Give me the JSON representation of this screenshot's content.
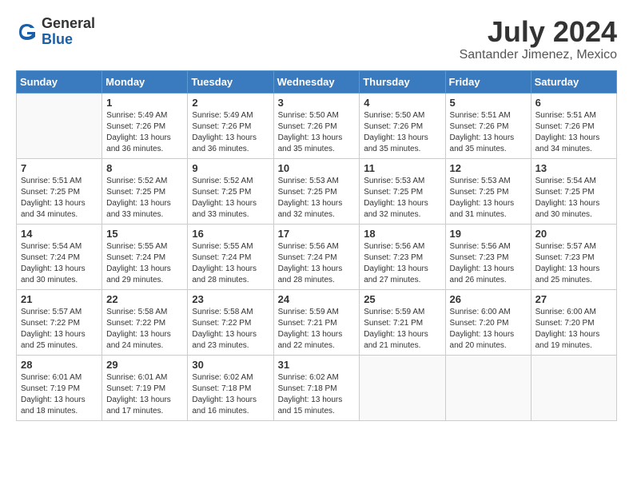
{
  "logo": {
    "general": "General",
    "blue": "Blue"
  },
  "title": {
    "month_year": "July 2024",
    "location": "Santander Jimenez, Mexico"
  },
  "headers": [
    "Sunday",
    "Monday",
    "Tuesday",
    "Wednesday",
    "Thursday",
    "Friday",
    "Saturday"
  ],
  "weeks": [
    [
      {
        "day": "",
        "info": ""
      },
      {
        "day": "1",
        "info": "Sunrise: 5:49 AM\nSunset: 7:26 PM\nDaylight: 13 hours\nand 36 minutes."
      },
      {
        "day": "2",
        "info": "Sunrise: 5:49 AM\nSunset: 7:26 PM\nDaylight: 13 hours\nand 36 minutes."
      },
      {
        "day": "3",
        "info": "Sunrise: 5:50 AM\nSunset: 7:26 PM\nDaylight: 13 hours\nand 35 minutes."
      },
      {
        "day": "4",
        "info": "Sunrise: 5:50 AM\nSunset: 7:26 PM\nDaylight: 13 hours\nand 35 minutes."
      },
      {
        "day": "5",
        "info": "Sunrise: 5:51 AM\nSunset: 7:26 PM\nDaylight: 13 hours\nand 35 minutes."
      },
      {
        "day": "6",
        "info": "Sunrise: 5:51 AM\nSunset: 7:26 PM\nDaylight: 13 hours\nand 34 minutes."
      }
    ],
    [
      {
        "day": "7",
        "info": "Sunrise: 5:51 AM\nSunset: 7:25 PM\nDaylight: 13 hours\nand 34 minutes."
      },
      {
        "day": "8",
        "info": "Sunrise: 5:52 AM\nSunset: 7:25 PM\nDaylight: 13 hours\nand 33 minutes."
      },
      {
        "day": "9",
        "info": "Sunrise: 5:52 AM\nSunset: 7:25 PM\nDaylight: 13 hours\nand 33 minutes."
      },
      {
        "day": "10",
        "info": "Sunrise: 5:53 AM\nSunset: 7:25 PM\nDaylight: 13 hours\nand 32 minutes."
      },
      {
        "day": "11",
        "info": "Sunrise: 5:53 AM\nSunset: 7:25 PM\nDaylight: 13 hours\nand 32 minutes."
      },
      {
        "day": "12",
        "info": "Sunrise: 5:53 AM\nSunset: 7:25 PM\nDaylight: 13 hours\nand 31 minutes."
      },
      {
        "day": "13",
        "info": "Sunrise: 5:54 AM\nSunset: 7:25 PM\nDaylight: 13 hours\nand 30 minutes."
      }
    ],
    [
      {
        "day": "14",
        "info": "Sunrise: 5:54 AM\nSunset: 7:24 PM\nDaylight: 13 hours\nand 30 minutes."
      },
      {
        "day": "15",
        "info": "Sunrise: 5:55 AM\nSunset: 7:24 PM\nDaylight: 13 hours\nand 29 minutes."
      },
      {
        "day": "16",
        "info": "Sunrise: 5:55 AM\nSunset: 7:24 PM\nDaylight: 13 hours\nand 28 minutes."
      },
      {
        "day": "17",
        "info": "Sunrise: 5:56 AM\nSunset: 7:24 PM\nDaylight: 13 hours\nand 28 minutes."
      },
      {
        "day": "18",
        "info": "Sunrise: 5:56 AM\nSunset: 7:23 PM\nDaylight: 13 hours\nand 27 minutes."
      },
      {
        "day": "19",
        "info": "Sunrise: 5:56 AM\nSunset: 7:23 PM\nDaylight: 13 hours\nand 26 minutes."
      },
      {
        "day": "20",
        "info": "Sunrise: 5:57 AM\nSunset: 7:23 PM\nDaylight: 13 hours\nand 25 minutes."
      }
    ],
    [
      {
        "day": "21",
        "info": "Sunrise: 5:57 AM\nSunset: 7:22 PM\nDaylight: 13 hours\nand 25 minutes."
      },
      {
        "day": "22",
        "info": "Sunrise: 5:58 AM\nSunset: 7:22 PM\nDaylight: 13 hours\nand 24 minutes."
      },
      {
        "day": "23",
        "info": "Sunrise: 5:58 AM\nSunset: 7:22 PM\nDaylight: 13 hours\nand 23 minutes."
      },
      {
        "day": "24",
        "info": "Sunrise: 5:59 AM\nSunset: 7:21 PM\nDaylight: 13 hours\nand 22 minutes."
      },
      {
        "day": "25",
        "info": "Sunrise: 5:59 AM\nSunset: 7:21 PM\nDaylight: 13 hours\nand 21 minutes."
      },
      {
        "day": "26",
        "info": "Sunrise: 6:00 AM\nSunset: 7:20 PM\nDaylight: 13 hours\nand 20 minutes."
      },
      {
        "day": "27",
        "info": "Sunrise: 6:00 AM\nSunset: 7:20 PM\nDaylight: 13 hours\nand 19 minutes."
      }
    ],
    [
      {
        "day": "28",
        "info": "Sunrise: 6:01 AM\nSunset: 7:19 PM\nDaylight: 13 hours\nand 18 minutes."
      },
      {
        "day": "29",
        "info": "Sunrise: 6:01 AM\nSunset: 7:19 PM\nDaylight: 13 hours\nand 17 minutes."
      },
      {
        "day": "30",
        "info": "Sunrise: 6:02 AM\nSunset: 7:18 PM\nDaylight: 13 hours\nand 16 minutes."
      },
      {
        "day": "31",
        "info": "Sunrise: 6:02 AM\nSunset: 7:18 PM\nDaylight: 13 hours\nand 15 minutes."
      },
      {
        "day": "",
        "info": ""
      },
      {
        "day": "",
        "info": ""
      },
      {
        "day": "",
        "info": ""
      }
    ]
  ]
}
